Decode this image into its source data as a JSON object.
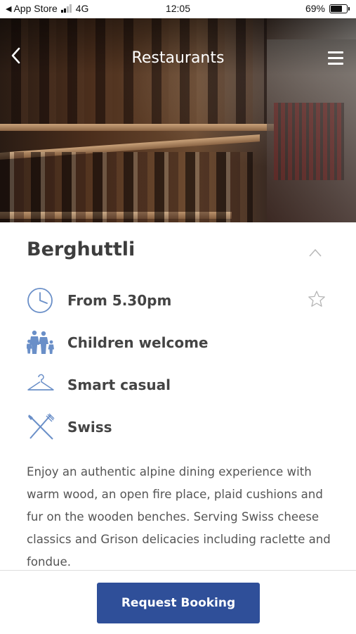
{
  "status_bar": {
    "back_app": "App Store",
    "network": "4G",
    "time": "12:05",
    "battery": "69%"
  },
  "nav": {
    "title": "Restaurants",
    "back_icon": "back-chevron-icon",
    "menu_icon": "hamburger-menu-icon"
  },
  "restaurant": {
    "name": "Berghuttli",
    "details": [
      {
        "icon": "clock-icon",
        "label": "From 5.30pm"
      },
      {
        "icon": "family-icon",
        "label": "Children welcome"
      },
      {
        "icon": "hanger-icon",
        "label": "Smart casual"
      },
      {
        "icon": "cutlery-icon",
        "label": "Swiss"
      }
    ],
    "description": "Enjoy an authentic alpine dining experience with warm wood, an open fire place, plaid cushions and fur on the wooden benches. Serving Swiss cheese classics and Grison delicacies including raclette and fondue."
  },
  "actions": {
    "booking_label": "Request Booking"
  },
  "colors": {
    "accent": "#2f4f99",
    "icon": "#6a8fc8"
  }
}
